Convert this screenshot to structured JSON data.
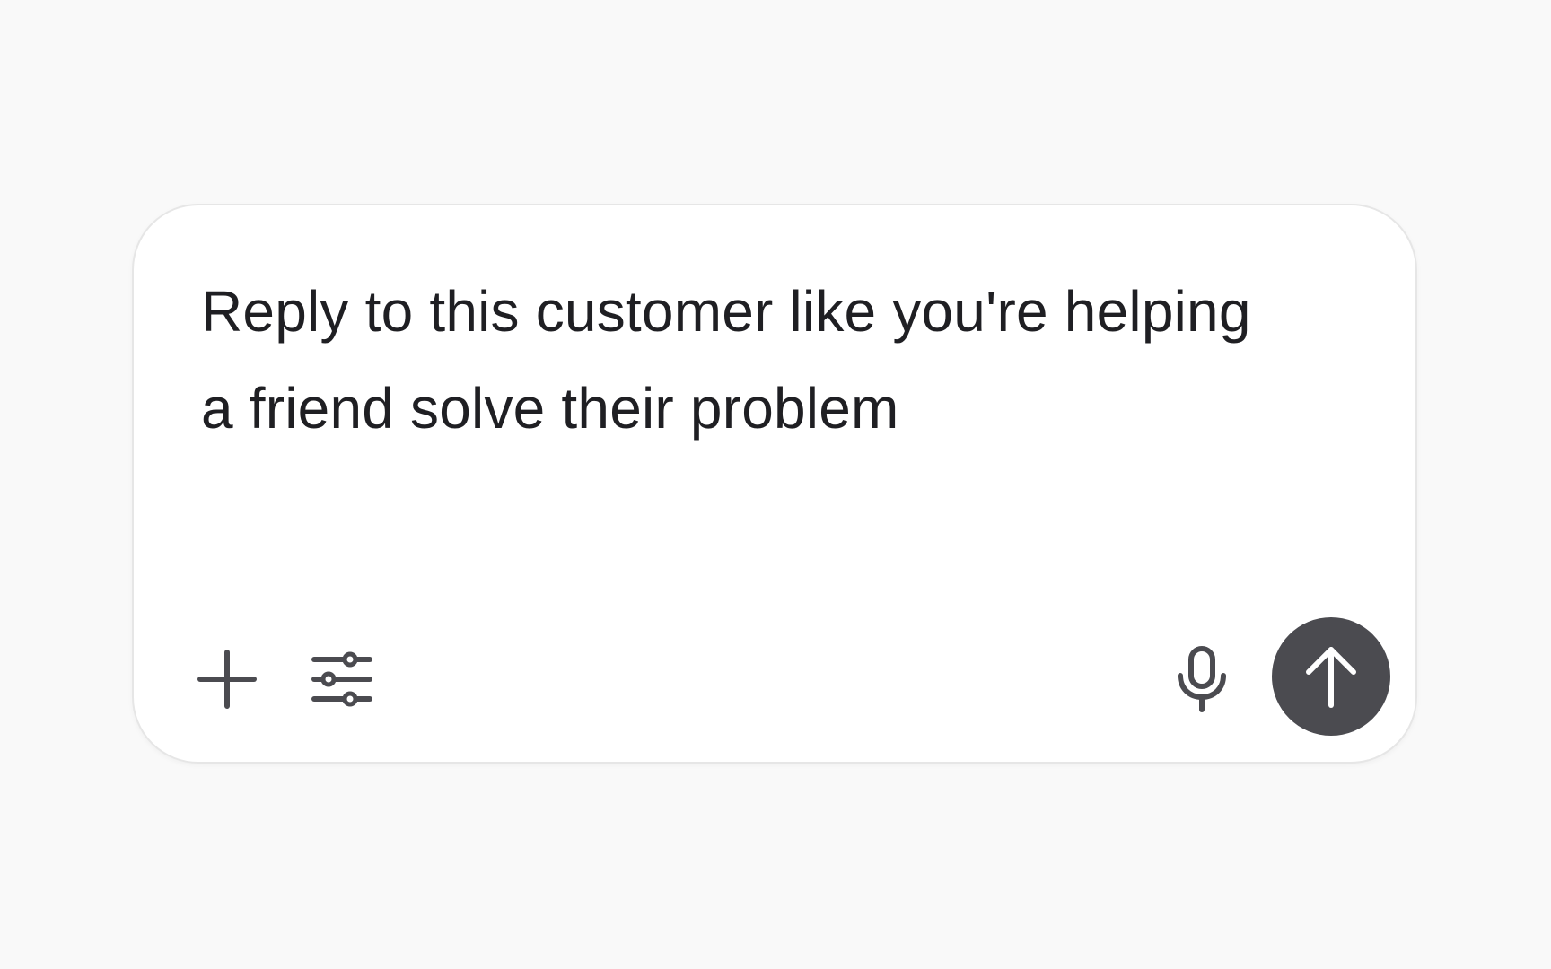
{
  "composer": {
    "text": "Reply to this customer like you're helping a friend solve their problem"
  },
  "toolbar": {
    "add_icon": "plus-icon",
    "tools_icon": "sliders-icon",
    "mic_icon": "microphone-icon",
    "send_icon": "arrow-up-icon"
  },
  "colors": {
    "background": "#f9f9f9",
    "card": "#ffffff",
    "text": "#1f1f23",
    "icon": "#4b4b50",
    "send_button": "#4b4b50"
  }
}
